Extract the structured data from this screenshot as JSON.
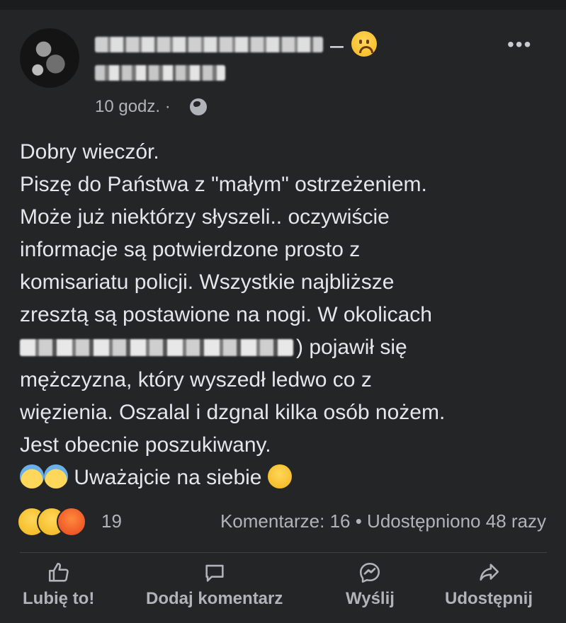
{
  "post": {
    "author_emoji": "worried-face",
    "dash": "–",
    "more_label": "•••",
    "time": "10 godz. ·",
    "text_lines": [
      "Dobry wieczór.",
      "Piszę do Państwa z \"małym\" ostrzeżeniem.",
      "Może już niektórzy słyszeli.. oczywiście",
      "informacje są potwierdzone prosto z",
      "komisariatu policji. Wszystkie najbliższe",
      "zresztą są postawione na nogi. W okolicach"
    ],
    "line_after_blur": ") pojawił się",
    "text_lines_2": [
      "mężczyzna, który wyszedł ledwo co z",
      "więzienia. Oszalal i dzgnal kilka osób nożem.",
      "Jest obecnie poszukiwany."
    ],
    "final_line": "Uważajcie na siebie"
  },
  "reactions": {
    "count": "19",
    "icons": [
      "wow-reaction-icon",
      "sad-reaction-icon",
      "angry-reaction-icon"
    ]
  },
  "stats": {
    "text": "Komentarze: 16 • Udostępniono 48 razy"
  },
  "actions": [
    {
      "label": "Lubię to!",
      "icon": "thumb-up-icon"
    },
    {
      "label": "Dodaj komentarz",
      "icon": "comment-icon"
    },
    {
      "label": "Wyślij",
      "icon": "messenger-icon"
    },
    {
      "label": "Udostępnij",
      "icon": "share-icon"
    }
  ],
  "colors": {
    "background": "#242526",
    "text": "#e4e6eb",
    "secondary": "#b0b3b8"
  }
}
